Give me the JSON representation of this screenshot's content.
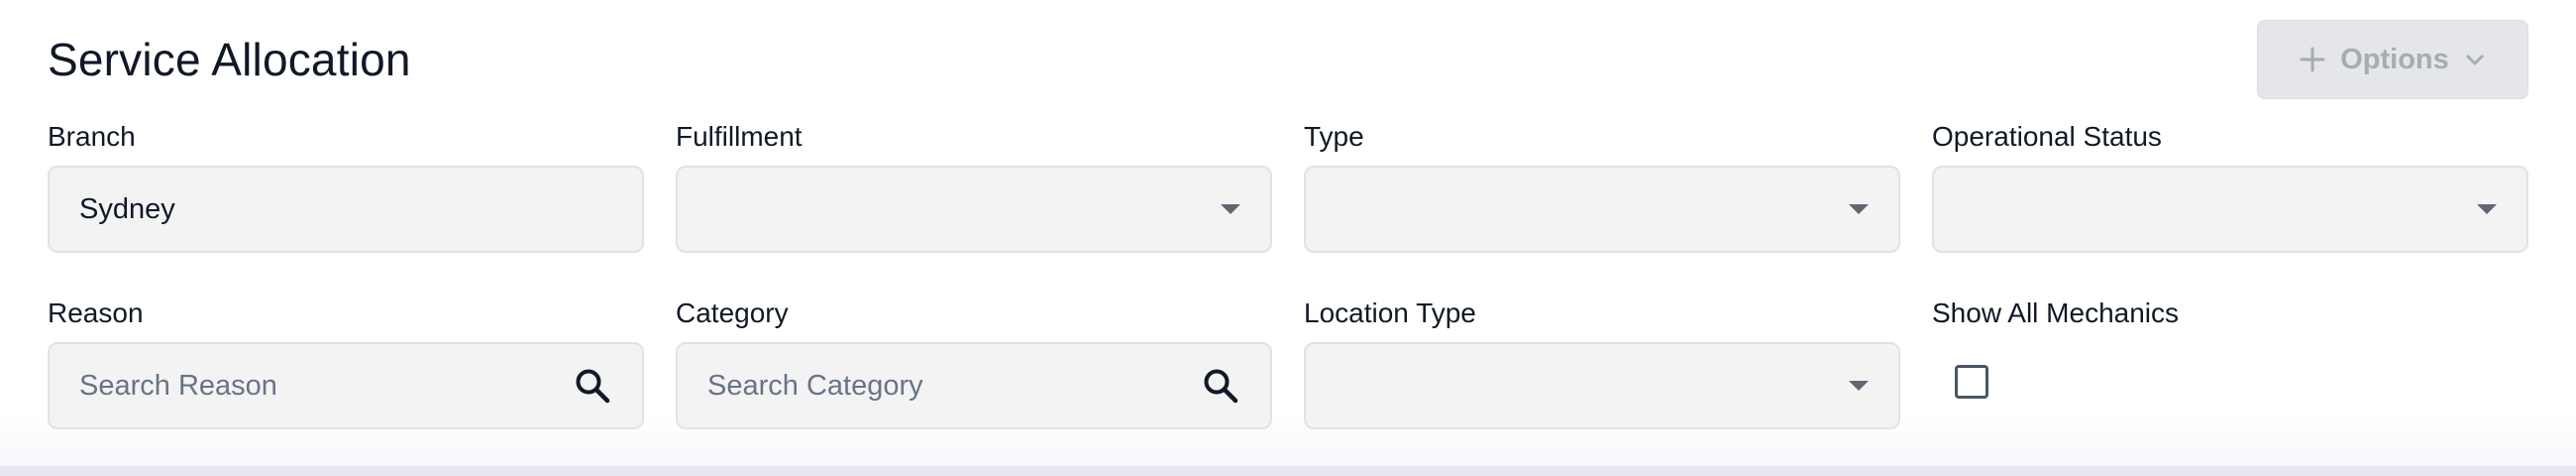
{
  "header": {
    "title": "Service Allocation",
    "options_button": {
      "label": "Options",
      "plus_icon": "plus-icon",
      "chevron_icon": "chevron-down-icon"
    }
  },
  "filters": {
    "branch": {
      "label": "Branch",
      "value": "Sydney"
    },
    "fulfillment": {
      "label": "Fulfillment",
      "value": ""
    },
    "type": {
      "label": "Type",
      "value": ""
    },
    "operational_status": {
      "label": "Operational Status",
      "value": ""
    },
    "reason": {
      "label": "Reason",
      "placeholder": "Search Reason",
      "icon": "search-icon"
    },
    "category": {
      "label": "Category",
      "placeholder": "Search Category",
      "icon": "search-icon"
    },
    "location_type": {
      "label": "Location Type",
      "value": ""
    },
    "show_all_mechanics": {
      "label": "Show All Mechanics",
      "checked": false
    }
  },
  "colors": {
    "field_bg": "#f3f3f4",
    "field_border": "#e1e2e6",
    "disabled_button_bg": "#e5e6e9",
    "disabled_button_text": "#a7abb3",
    "placeholder_text": "#697386"
  }
}
